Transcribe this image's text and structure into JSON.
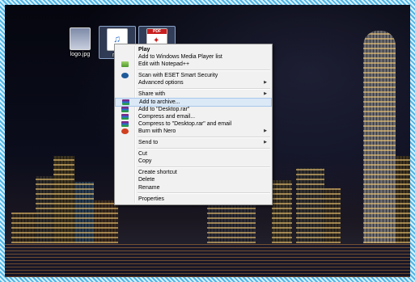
{
  "desktop": {
    "icons": [
      {
        "label": "logo.jpg",
        "icon": "image-file-icon"
      },
      {
        "label": "ra...",
        "icon": "audio-file-icon"
      },
      {
        "label": "",
        "icon": "pdf-file-icon",
        "badge": "PDF"
      }
    ]
  },
  "context_menu": {
    "groups": [
      [
        {
          "label": "Play",
          "bold": true
        },
        {
          "label": "Add to Windows Media Player list"
        },
        {
          "label": "Edit with Notepad++",
          "icon": "notepad-icon"
        }
      ],
      [
        {
          "label": "Scan with ESET Smart Security",
          "icon": "eset-icon"
        },
        {
          "label": "Advanced options",
          "submenu": true
        }
      ],
      [
        {
          "label": "Share with",
          "submenu": true
        },
        {
          "label": "Add to archive...",
          "icon": "winrar-icon",
          "highlight": true
        },
        {
          "label": "Add to \"Desktop.rar\"",
          "icon": "winrar-icon"
        },
        {
          "label": "Compress and email...",
          "icon": "winrar-icon"
        },
        {
          "label": "Compress to \"Desktop.rar\" and email",
          "icon": "winrar-icon"
        },
        {
          "label": "Burn with Nero",
          "icon": "nero-icon",
          "submenu": true
        }
      ],
      [
        {
          "label": "Send to",
          "submenu": true
        }
      ],
      [
        {
          "label": "Cut"
        },
        {
          "label": "Copy"
        }
      ],
      [
        {
          "label": "Create shortcut"
        },
        {
          "label": "Delete"
        },
        {
          "label": "Rename"
        }
      ],
      [
        {
          "label": "Properties"
        }
      ]
    ]
  },
  "colors": {
    "accent": "#4fb6e6",
    "highlight": "#dbe8f6"
  }
}
